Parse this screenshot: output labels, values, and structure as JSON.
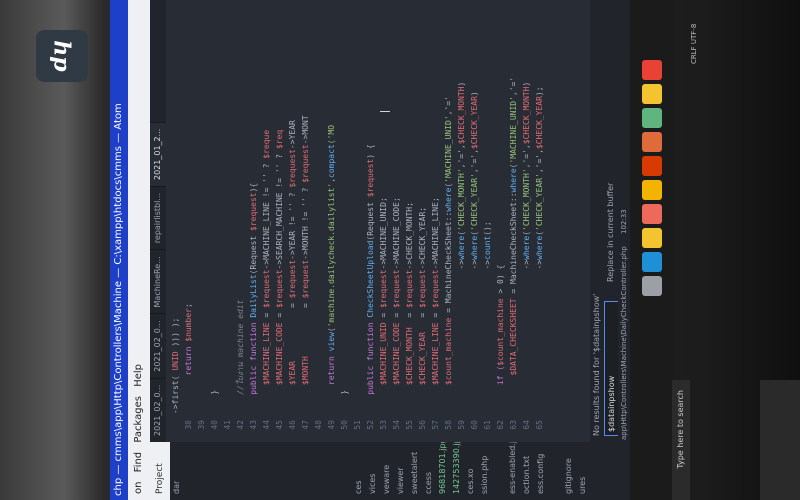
{
  "window": {
    "title": "chp — cmms\\app\\Http\\Controllers\\Machine — C:\\xampp\\htdocs\\cmms — Atom"
  },
  "menu": [
    "on",
    "Find",
    "Packages",
    "Help"
  ],
  "treeview": {
    "header": "Project",
    "items": [
      {
        "label": "dar",
        "green": false
      },
      {
        "label": "",
        "green": false
      },
      {
        "label": "",
        "green": false
      },
      {
        "label": "",
        "green": false
      },
      {
        "label": "",
        "green": false
      },
      {
        "label": "",
        "green": false
      },
      {
        "label": "",
        "green": false
      },
      {
        "label": "",
        "green": false
      },
      {
        "label": "",
        "green": false
      },
      {
        "label": "",
        "green": false
      },
      {
        "label": "",
        "green": false
      },
      {
        "label": "",
        "green": false
      },
      {
        "label": "",
        "green": false
      },
      {
        "label": "ces",
        "green": false
      },
      {
        "label": "vices",
        "green": false
      },
      {
        "label": "veware",
        "green": false
      },
      {
        "label": "viewer",
        "green": false
      },
      {
        "label": "sweetalert",
        "green": false
      },
      {
        "label": "ccess",
        "green": false
      },
      {
        "label": "96818701.jpg",
        "green": true
      },
      {
        "label": "142753390.jpg",
        "green": true
      },
      {
        "label": "ces.xo",
        "green": false
      },
      {
        "label": "ssion.php",
        "green": false
      },
      {
        "label": "",
        "green": false
      },
      {
        "label": "ess-enabled.json",
        "green": false
      },
      {
        "label": "oction.txt",
        "green": false
      },
      {
        "label": "ess.config",
        "green": false
      },
      {
        "label": "",
        "green": false
      },
      {
        "label": "gitignore",
        "green": false
      },
      {
        "label": "ures",
        "green": false
      }
    ]
  },
  "tabs": [
    {
      "label": "2021_02_0...",
      "active": false
    },
    {
      "label": "2021_02_0...",
      "active": false
    },
    {
      "label": "MachineRe...",
      "active": false
    },
    {
      "label": "repairlistbl...",
      "active": false
    },
    {
      "label": "2021_01_2...",
      "active": true
    }
  ],
  "code_lines": [
    {
      "n": "",
      "segments": [
        {
          "t": "->first( ",
          "c": "c-txt"
        },
        {
          "t": "UNID",
          "c": "c-var"
        },
        {
          "t": " ))) );",
          "c": "c-txt"
        }
      ]
    },
    {
      "n": "38",
      "segments": [
        {
          "t": "        return ",
          "c": "c-kw"
        },
        {
          "t": "$number",
          "c": "c-var"
        },
        {
          "t": ";",
          "c": "c-txt"
        }
      ]
    },
    {
      "n": "39",
      "segments": []
    },
    {
      "n": "40",
      "segments": [
        {
          "t": "    }",
          "c": "c-txt"
        }
      ]
    },
    {
      "n": "41",
      "segments": []
    },
    {
      "n": "42",
      "segments": [
        {
          "t": "    //ใบงาน machine edit",
          "c": "c-cm"
        }
      ]
    },
    {
      "n": "43",
      "segments": [
        {
          "t": "    public function ",
          "c": "c-kw"
        },
        {
          "t": "DailyList",
          "c": "c-fn"
        },
        {
          "t": "(Request ",
          "c": "c-txt"
        },
        {
          "t": "$request",
          "c": "c-var"
        },
        {
          "t": "){",
          "c": "c-txt"
        }
      ]
    },
    {
      "n": "44",
      "segments": [
        {
          "t": "      ",
          "c": "c-txt"
        },
        {
          "t": "$MACHINE_LINE",
          "c": "c-var"
        },
        {
          "t": " = ",
          "c": "c-txt"
        },
        {
          "t": "$request",
          "c": "c-var"
        },
        {
          "t": "->MACHINE_LINE != '' ? ",
          "c": "c-txt"
        },
        {
          "t": "$reque",
          "c": "c-var"
        }
      ]
    },
    {
      "n": "45",
      "segments": [
        {
          "t": "      ",
          "c": "c-txt"
        },
        {
          "t": "$MACHINE_CODE",
          "c": "c-var"
        },
        {
          "t": " = ",
          "c": "c-txt"
        },
        {
          "t": "$request",
          "c": "c-var"
        },
        {
          "t": "->SEARCH_MACHINE != '' ? ",
          "c": "c-txt"
        },
        {
          "t": "$req",
          "c": "c-var"
        }
      ]
    },
    {
      "n": "46",
      "segments": [
        {
          "t": "      ",
          "c": "c-txt"
        },
        {
          "t": "$YEAR",
          "c": "c-var"
        },
        {
          "t": "           = ",
          "c": "c-txt"
        },
        {
          "t": "$request",
          "c": "c-var"
        },
        {
          "t": "->YEAR != '' ? ",
          "c": "c-txt"
        },
        {
          "t": "$request",
          "c": "c-var"
        },
        {
          "t": "->YEAR",
          "c": "c-txt"
        }
      ]
    },
    {
      "n": "47",
      "segments": [
        {
          "t": "      ",
          "c": "c-txt"
        },
        {
          "t": "$MONTH",
          "c": "c-var"
        },
        {
          "t": "          = ",
          "c": "c-txt"
        },
        {
          "t": "$request",
          "c": "c-var"
        },
        {
          "t": "->MONTH != '' ? ",
          "c": "c-txt"
        },
        {
          "t": "$request",
          "c": "c-var"
        },
        {
          "t": "->MONT",
          "c": "c-txt"
        }
      ]
    },
    {
      "n": "48",
      "segments": []
    },
    {
      "n": "49",
      "segments": [
        {
          "t": "      return ",
          "c": "c-kw"
        },
        {
          "t": "view",
          "c": "c-fn"
        },
        {
          "t": "(",
          "c": "c-txt"
        },
        {
          "t": "'machine.dailycheck.dailylist'",
          "c": "c-str"
        },
        {
          "t": ",",
          "c": "c-txt"
        },
        {
          "t": "compact",
          "c": "c-fn"
        },
        {
          "t": "('MO",
          "c": "c-str"
        }
      ]
    },
    {
      "n": "50",
      "segments": [
        {
          "t": "    }",
          "c": "c-txt"
        }
      ]
    },
    {
      "n": "51",
      "segments": []
    },
    {
      "n": "52",
      "segments": [
        {
          "t": "    public function ",
          "c": "c-kw"
        },
        {
          "t": "CheckSheetUpload",
          "c": "c-fn"
        },
        {
          "t": "(Request ",
          "c": "c-txt"
        },
        {
          "t": "$request",
          "c": "c-var"
        },
        {
          "t": ") {",
          "c": "c-txt"
        }
      ]
    },
    {
      "n": "53",
      "segments": [
        {
          "t": "      ",
          "c": "c-txt"
        },
        {
          "t": "$MACHINE_UNID",
          "c": "c-var"
        },
        {
          "t": " = ",
          "c": "c-txt"
        },
        {
          "t": "$request",
          "c": "c-var"
        },
        {
          "t": "->MACHINE_UNID;",
          "c": "c-txt"
        }
      ]
    },
    {
      "n": "54",
      "segments": [
        {
          "t": "      ",
          "c": "c-txt"
        },
        {
          "t": "$MACHINE_CODE",
          "c": "c-var"
        },
        {
          "t": " = ",
          "c": "c-txt"
        },
        {
          "t": "$request",
          "c": "c-var"
        },
        {
          "t": "->MACHINE_CODE;",
          "c": "c-txt"
        }
      ]
    },
    {
      "n": "55",
      "segments": [
        {
          "t": "      ",
          "c": "c-txt"
        },
        {
          "t": "$CHECK_MONTH",
          "c": "c-var"
        },
        {
          "t": "  = ",
          "c": "c-txt"
        },
        {
          "t": "$request",
          "c": "c-var"
        },
        {
          "t": "->CHECK_MONTH;",
          "c": "c-txt"
        }
      ]
    },
    {
      "n": "56",
      "segments": [
        {
          "t": "      ",
          "c": "c-txt"
        },
        {
          "t": "$CHECK_YEAR",
          "c": "c-var"
        },
        {
          "t": "   = ",
          "c": "c-txt"
        },
        {
          "t": "$request",
          "c": "c-var"
        },
        {
          "t": "->CHECK_YEAR;",
          "c": "c-txt"
        }
      ]
    },
    {
      "n": "57",
      "segments": [
        {
          "t": "      ",
          "c": "c-txt"
        },
        {
          "t": "$MACHINE_LINE",
          "c": "c-var"
        },
        {
          "t": " = ",
          "c": "c-txt"
        },
        {
          "t": "$request",
          "c": "c-var"
        },
        {
          "t": "->MACHINE_LINE;",
          "c": "c-txt"
        }
      ]
    },
    {
      "n": "58",
      "segments": [
        {
          "t": "      ",
          "c": "c-txt"
        },
        {
          "t": "$count_machine",
          "c": "c-var"
        },
        {
          "t": " = MachineCheckSheet::",
          "c": "c-txt"
        },
        {
          "t": "where",
          "c": "c-fn"
        },
        {
          "t": "(",
          "c": "c-txt"
        },
        {
          "t": "'MACHINE_UNID'",
          "c": "c-str"
        },
        {
          "t": ",'='",
          "c": "c-txt"
        }
      ]
    },
    {
      "n": "59",
      "segments": [
        {
          "t": "                              ->",
          "c": "c-txt"
        },
        {
          "t": "where",
          "c": "c-fn"
        },
        {
          "t": "(",
          "c": "c-txt"
        },
        {
          "t": "'CHECK_MONTH'",
          "c": "c-str"
        },
        {
          "t": ",'=',",
          "c": "c-txt"
        },
        {
          "t": "$CHECK_MONTH",
          "c": "c-var"
        },
        {
          "t": ")",
          "c": "c-txt"
        }
      ]
    },
    {
      "n": "60",
      "segments": [
        {
          "t": "                              ->",
          "c": "c-txt"
        },
        {
          "t": "where",
          "c": "c-fn"
        },
        {
          "t": "(",
          "c": "c-txt"
        },
        {
          "t": "'CHECK_YEAR'",
          "c": "c-str"
        },
        {
          "t": ",'=',",
          "c": "c-txt"
        },
        {
          "t": "$CHECK_YEAR",
          "c": "c-var"
        },
        {
          "t": ")",
          "c": "c-txt"
        }
      ]
    },
    {
      "n": "61",
      "segments": [
        {
          "t": "                              ->",
          "c": "c-txt"
        },
        {
          "t": "count",
          "c": "c-fn"
        },
        {
          "t": "();",
          "c": "c-txt"
        }
      ]
    },
    {
      "n": "62",
      "segments": [
        {
          "t": "      if (",
          "c": "c-kw"
        },
        {
          "t": "$count_machine",
          "c": "c-var"
        },
        {
          "t": " > 0) {",
          "c": "c-txt"
        }
      ]
    },
    {
      "n": "63",
      "segments": [
        {
          "t": "        ",
          "c": "c-txt"
        },
        {
          "t": "$DATA_CHECKSHEET",
          "c": "c-var"
        },
        {
          "t": " = MachineCheckSheet::",
          "c": "c-txt"
        },
        {
          "t": "where",
          "c": "c-fn"
        },
        {
          "t": "(",
          "c": "c-txt"
        },
        {
          "t": "'MACHINE_UNID'",
          "c": "c-str"
        },
        {
          "t": ",'='",
          "c": "c-txt"
        }
      ]
    },
    {
      "n": "64",
      "segments": [
        {
          "t": "                              ->",
          "c": "c-txt"
        },
        {
          "t": "where",
          "c": "c-fn"
        },
        {
          "t": "(",
          "c": "c-txt"
        },
        {
          "t": "'CHECK_MONTH'",
          "c": "c-str"
        },
        {
          "t": ",'=',",
          "c": "c-txt"
        },
        {
          "t": "$CHECK_MONTH",
          "c": "c-var"
        },
        {
          "t": ")",
          "c": "c-txt"
        }
      ]
    },
    {
      "n": "65",
      "segments": [
        {
          "t": "                              ->",
          "c": "c-txt"
        },
        {
          "t": "where",
          "c": "c-fn"
        },
        {
          "t": "(",
          "c": "c-txt"
        },
        {
          "t": "'CHECK_YEAR'",
          "c": "c-str"
        },
        {
          "t": ",'=',",
          "c": "c-txt"
        },
        {
          "t": "$CHECK_YEAR",
          "c": "c-var"
        },
        {
          "t": ");",
          "c": "c-txt"
        }
      ]
    }
  ],
  "find": {
    "message": "No results found for '$datainpshow'",
    "value": "$datainpshow",
    "replace_label": "Replace in current buffer"
  },
  "statusbar": {
    "path": "app\\Http\\Controllers\\Machine\\DailyCheckController.php",
    "position": "102:33"
  },
  "taskbar": {
    "search_placeholder": "Type here to search",
    "tray_text": "CRLF  UTF-8"
  },
  "monitor": {
    "brand": "hp"
  },
  "colors": {
    "title_bar": "#1e40c8",
    "editor_bg": "#282c34",
    "keyword": "#c678dd",
    "function": "#61afef",
    "variable": "#e06c75",
    "string": "#98c379"
  },
  "taskbar_icons": [
    {
      "name": "chrome-icon",
      "color": "#e94235"
    },
    {
      "name": "file-explorer-icon",
      "color": "#f4c430"
    },
    {
      "name": "atom-icon",
      "color": "#5fb57d"
    },
    {
      "name": "mail-icon",
      "color": "#e06b3a"
    },
    {
      "name": "app-icon",
      "color": "#d83b01"
    },
    {
      "name": "word-icon",
      "color": "#f2b400"
    },
    {
      "name": "excel-icon",
      "color": "#ed6a5a"
    },
    {
      "name": "store-icon",
      "color": "#f4c430"
    },
    {
      "name": "edge-icon",
      "color": "#1f8fd6"
    },
    {
      "name": "settings-icon",
      "color": "#9aa0a6"
    }
  ]
}
